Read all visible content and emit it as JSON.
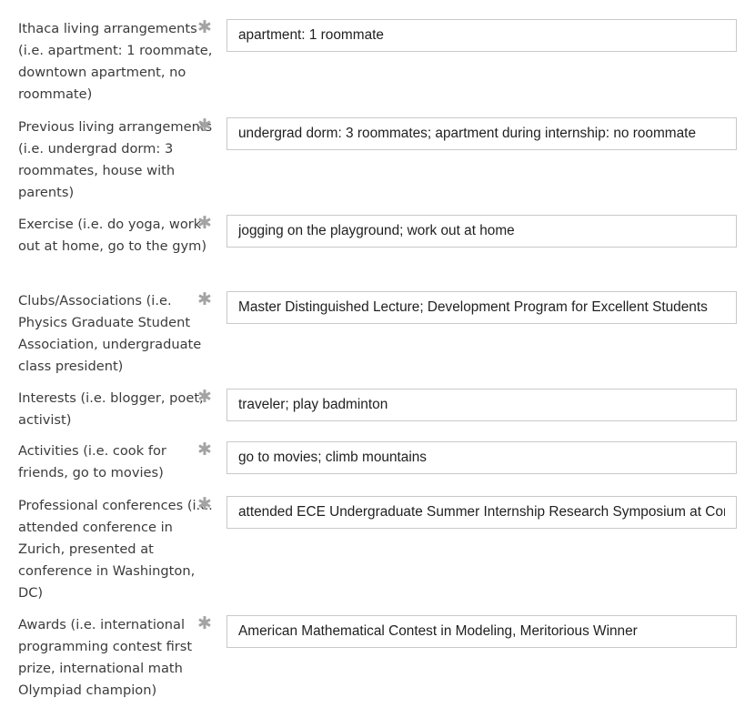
{
  "form": {
    "required_marker": "✱",
    "fields": [
      {
        "label": "Ithaca living arrangements (i.e. apartment: 1 roommate, downtown apartment, no roommate)",
        "value": "apartment: 1 roommate"
      },
      {
        "label": "Previous living arrangements (i.e. undergrad dorm: 3 roommates, house with parents)",
        "value": "undergrad dorm: 3 roommates; apartment during internship: no roommate"
      },
      {
        "label": "Exercise (i.e. do yoga, work out at home, go to the gym)",
        "value": "jogging on the playground; work out at home"
      },
      {
        "label": "Clubs/Associations (i.e. Physics Graduate Student Association, undergraduate class president)",
        "value": "Master Distinguished Lecture; Development Program for Excellent Students"
      },
      {
        "label": "Interests (i.e. blogger, poet, activist)",
        "value": "traveler; play badminton"
      },
      {
        "label": "Activities (i.e. cook for friends, go to movies)",
        "value": "go to movies; climb mountains"
      },
      {
        "label": "Professional conferences (i.e. attended conference in Zurich, presented at conference in Washington, DC)",
        "value": "attended ECE Undergraduate Summer Internship Research Symposium at Cornell"
      },
      {
        "label": "Awards (i.e. international programming contest first prize, international math Olympiad champion)",
        "value": "American Mathematical Contest in Modeling, Meritorious Winner"
      }
    ]
  },
  "colors": {
    "label_text": "#3b3b3b",
    "required_marker": "#a3a3a3",
    "input_border": "#c9c9c9",
    "input_text": "#1f1f1f",
    "background": "#ffffff"
  }
}
